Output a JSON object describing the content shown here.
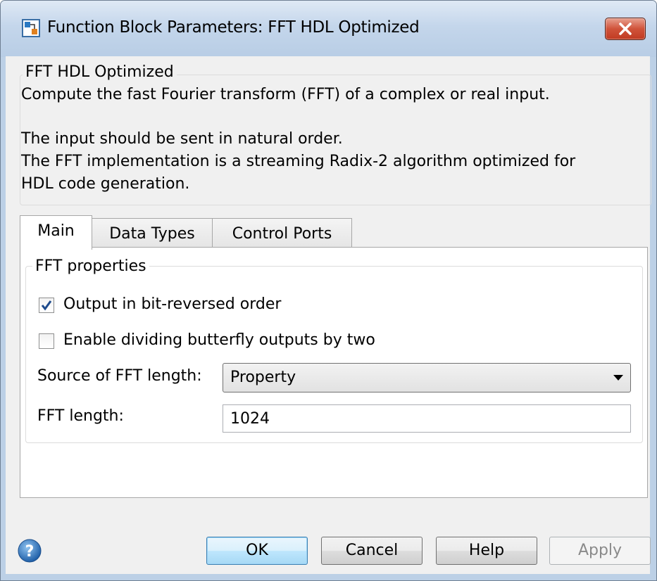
{
  "window": {
    "title": "Function Block Parameters: FFT HDL Optimized"
  },
  "description": {
    "group_title": "FFT HDL Optimized",
    "line1": "Compute the fast Fourier transform (FFT) of a complex or real input.",
    "line2": "The input should be sent in natural order.",
    "line3": "The FFT implementation is a streaming Radix-2 algorithm optimized for",
    "line4": "HDL code generation."
  },
  "tabs": [
    {
      "label": "Main",
      "active": true
    },
    {
      "label": "Data Types",
      "active": false
    },
    {
      "label": "Control Ports",
      "active": false
    }
  ],
  "fft_properties": {
    "group_title": "FFT properties",
    "bit_reversed": {
      "label": "Output in bit-reversed order",
      "checked": true
    },
    "divide_by_two": {
      "label": "Enable dividing butterfly outputs by two",
      "checked": false
    },
    "source_label": "Source of FFT length:",
    "source_value": "Property",
    "length_label": "FFT length:",
    "length_value": "1024"
  },
  "buttons": {
    "ok": "OK",
    "cancel": "Cancel",
    "help": "Help",
    "apply": "Apply"
  },
  "icons": {
    "app": "simulink-block-icon",
    "close": "close-icon",
    "help": "help-icon"
  }
}
